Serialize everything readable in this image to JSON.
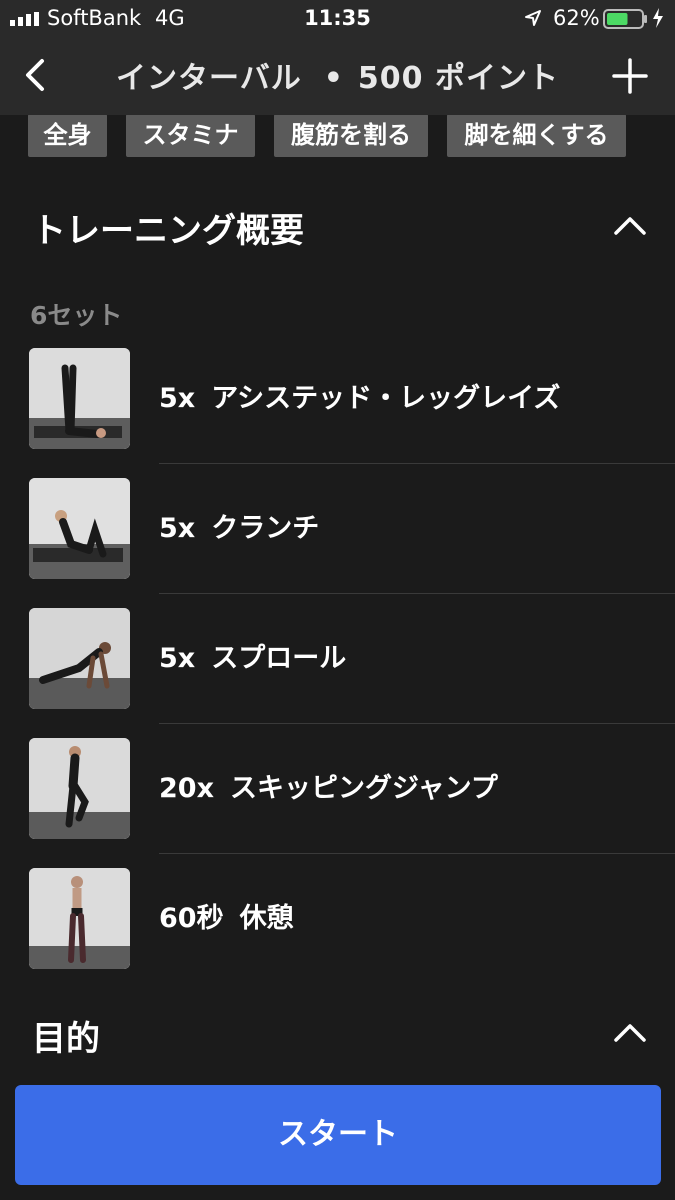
{
  "status_bar": {
    "carrier": "SoftBank",
    "network": "4G",
    "time": "11:35",
    "battery_percent": "62%",
    "battery_level": 0.62,
    "battery_color": "#4cd964"
  },
  "nav": {
    "title": "インターバル",
    "separator": "•",
    "points": "500 ポイント",
    "back_icon": "chevron-left",
    "add_icon": "plus"
  },
  "tags": [
    "全身",
    "スタミナ",
    "腹筋を割る",
    "脚を細くする"
  ],
  "overview": {
    "heading": "トレーニング概要",
    "sets_label": "6セット",
    "exercises": [
      {
        "count": "5x",
        "name": "アシステッド・レッグレイズ"
      },
      {
        "count": "5x",
        "name": "クランチ"
      },
      {
        "count": "5x",
        "name": "スプロール"
      },
      {
        "count": "20x",
        "name": "スキッピングジャンプ"
      },
      {
        "count": "60秒",
        "name": "休憩"
      }
    ]
  },
  "goal": {
    "heading": "目的"
  },
  "start_button": {
    "label": "スタート"
  },
  "colors": {
    "accent": "#3b6de8",
    "background": "#1b1b1b",
    "tag_bg": "#5a5a5a"
  }
}
